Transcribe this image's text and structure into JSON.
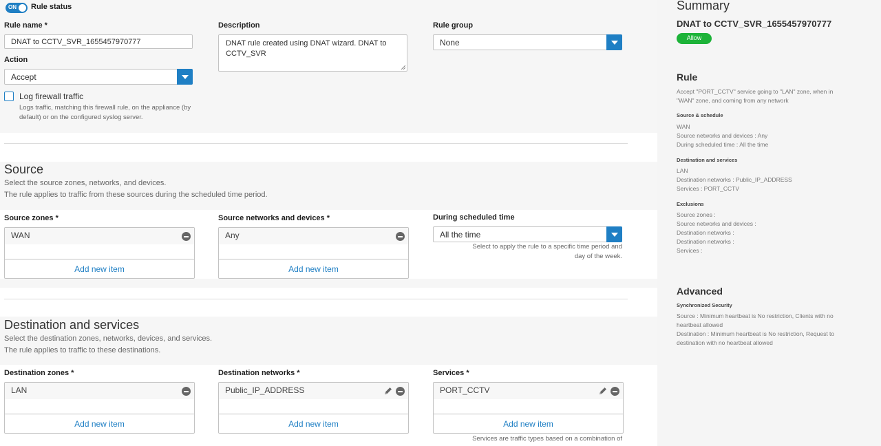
{
  "rule_status": {
    "toggle_text": "ON",
    "label": "Rule status"
  },
  "rule_name": {
    "label": "Rule name *",
    "value": "DNAT to CCTV_SVR_1655457970777"
  },
  "description": {
    "label": "Description",
    "value": "DNAT rule created using DNAT wizard. DNAT to CCTV_SVR"
  },
  "rule_group": {
    "label": "Rule group",
    "value": "None"
  },
  "action": {
    "label": "Action",
    "value": "Accept"
  },
  "log_traffic": {
    "label": "Log firewall traffic",
    "help_line1": "Logs traffic, matching this firewall rule, on the appliance (by",
    "help_line2": "default) or on the configured syslog server."
  },
  "source": {
    "title": "Source",
    "desc1": "Select the source zones, networks, and devices.",
    "desc2": "The rule applies to traffic from these sources during the scheduled time period.",
    "zones": {
      "label": "Source zones *",
      "item": "WAN",
      "add": "Add new item"
    },
    "networks": {
      "label": "Source networks and devices *",
      "item": "Any",
      "add": "Add new item"
    },
    "schedule": {
      "label": "During scheduled time",
      "value": "All the time",
      "help_line1": "Select to apply the rule to a specific time period and",
      "help_line2": "day of the week."
    }
  },
  "destination": {
    "title": "Destination and services",
    "desc1": "Select the destination zones, networks, devices, and services.",
    "desc2": "The rule applies to traffic to these destinations.",
    "zones": {
      "label": "Destination zones *",
      "item": "LAN",
      "add": "Add new item"
    },
    "networks": {
      "label": "Destination networks *",
      "item": "Public_IP_ADDRESS",
      "add": "Add new item"
    },
    "services": {
      "label": "Services *",
      "item": "PORT_CCTV",
      "add": "Add new item",
      "help": "Services are traffic types based on a combination of"
    }
  },
  "summary": {
    "title": "Summary",
    "rule_name": "DNAT to CCTV_SVR_1655457970777",
    "badge": "Allow",
    "rule_heading": "Rule",
    "rule_desc1": "Accept \"PORT_CCTV\" service going to \"LAN\" zone, when in",
    "rule_desc2": "\"WAN\" zone, and coming from any network",
    "source_heading": "Source & schedule",
    "source_lines": [
      "WAN",
      "Source networks and devices : Any",
      "During scheduled time : All the time"
    ],
    "dest_heading": "Destination and services",
    "dest_lines": [
      "LAN",
      "Destination networks : Public_IP_ADDRESS",
      "Services : PORT_CCTV"
    ],
    "excl_heading": "Exclusions",
    "excl_lines": [
      "Source zones :",
      "Source networks and devices :",
      "Destination networks :",
      "Destination networks :",
      "Services :"
    ],
    "advanced_heading": "Advanced",
    "sync_heading": "Synchronized Security",
    "sync_lines": [
      "Source : Minimum heartbeat is No restriction, Clients with no",
      "heartbeat allowed",
      "Destination : Minimum heartbeat is No restriction, Request to",
      "destination with no heartbeat allowed"
    ]
  },
  "colors": {
    "accent": "#1f7fc4",
    "allow_badge": "#1db339"
  },
  "icons": [
    "minus-circle-icon",
    "pencil-icon",
    "dropdown-arrow-icon"
  ]
}
